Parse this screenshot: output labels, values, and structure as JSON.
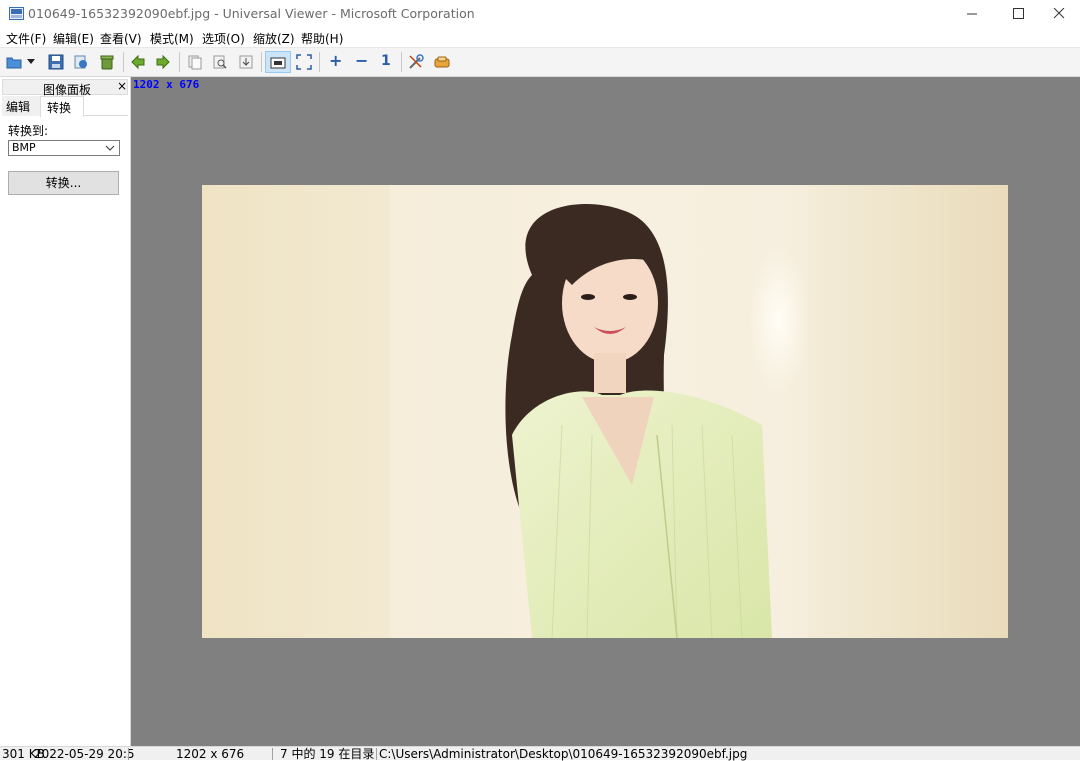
{
  "window": {
    "title": "010649-16532392090ebf.jpg - Universal Viewer - Microsoft Corporation",
    "controls": [
      "minimize",
      "maximize",
      "close"
    ]
  },
  "menu": {
    "items": [
      "文件(F)",
      "编辑(E)",
      "查看(V)",
      "模式(M)",
      "选项(O)",
      "缩放(Z)",
      "帮助(H)"
    ]
  },
  "toolbar": {
    "buttons": [
      {
        "icon": "open-folder-icon"
      },
      {
        "icon": "dropdown-arrow-icon"
      },
      {
        "icon": "save-disk-icon"
      },
      {
        "icon": "reload-icon"
      },
      {
        "icon": "trash-icon"
      },
      {
        "icon": "previous-arrow-icon"
      },
      {
        "icon": "next-arrow-icon"
      },
      {
        "icon": "copy-icon"
      },
      {
        "icon": "find-icon"
      },
      {
        "icon": "import-icon"
      },
      {
        "icon": "fit-window-icon",
        "active": true
      },
      {
        "icon": "fullscreen-icon"
      },
      {
        "icon": "zoom-in-icon"
      },
      {
        "icon": "zoom-out-icon"
      },
      {
        "icon": "actual-size-icon"
      },
      {
        "icon": "tools-icon"
      },
      {
        "icon": "plugin-icon"
      }
    ],
    "zoom_in_label": "+",
    "zoom_out_label": "−",
    "actual_size_label": "1"
  },
  "panel": {
    "title": "图像面板",
    "close": "×",
    "tabs": [
      "编辑",
      "转换"
    ],
    "active_tab": "转换",
    "convert_to_label": "转换到:",
    "format_selected": "BMP",
    "convert_button": "转换..."
  },
  "viewer": {
    "dims_overlay": "1202 x 676",
    "background": "#808080"
  },
  "status": {
    "size": "301 KB",
    "date": "2022-05-29 20:5",
    "dims": "1202 x 676",
    "index": "7 中的 19 在目录",
    "path": "C:\\Users\\Administrator\\Desktop\\010649-16532392090ebf.jpg"
  }
}
